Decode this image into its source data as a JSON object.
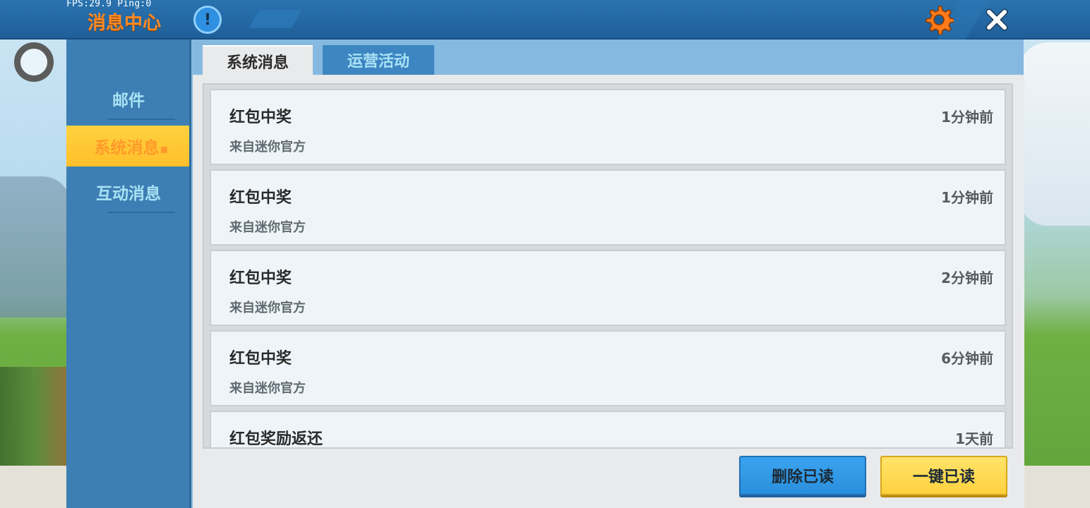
{
  "hud": {
    "fps_ping": "FPS:29.9  Ping:0"
  },
  "header": {
    "title": "消息中心",
    "info_symbol": "!"
  },
  "sidebar": {
    "items": [
      {
        "label": "邮件",
        "active": false
      },
      {
        "label": "系统消息",
        "active": true
      },
      {
        "label": "互动消息",
        "active": false
      }
    ]
  },
  "tabs": [
    {
      "label": "系统消息",
      "active": true
    },
    {
      "label": "运营活动",
      "active": false
    }
  ],
  "messages": [
    {
      "title": "红包中奖",
      "time": "1分钟前",
      "from": "来自迷你官方"
    },
    {
      "title": "红包中奖",
      "time": "1分钟前",
      "from": "来自迷你官方"
    },
    {
      "title": "红包中奖",
      "time": "2分钟前",
      "from": "来自迷你官方"
    },
    {
      "title": "红包中奖",
      "time": "6分钟前",
      "from": "来自迷你官方"
    },
    {
      "title": "红包奖励返还",
      "time": "1天前",
      "from": ""
    }
  ],
  "actions": {
    "delete_read": "删除已读",
    "mark_all_read": "一键已读"
  },
  "icons": {
    "settings": "gear-icon",
    "close": "close-icon",
    "info": "info-icon",
    "record": "ring-icon"
  },
  "colors": {
    "accent_orange": "#ff8a25",
    "header_blue": "#1f5f99",
    "sidebar_blue": "#3d7fb4",
    "active_yellow": "#ffd23f"
  }
}
